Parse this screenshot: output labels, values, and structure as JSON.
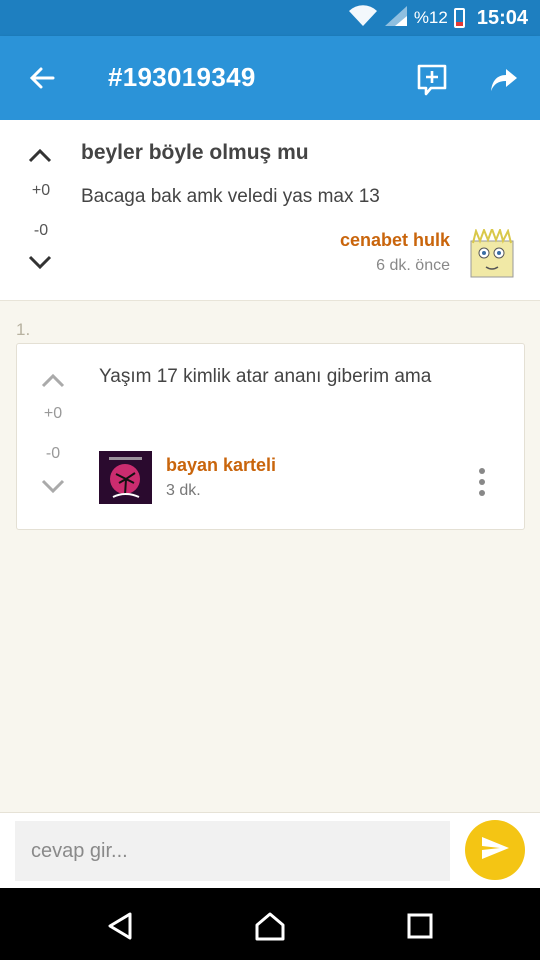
{
  "status_bar": {
    "battery": "%12",
    "time": "15:04",
    "icons": [
      "wifi-icon",
      "signal-icon",
      "battery-icon"
    ]
  },
  "app_bar": {
    "title": "#193019349",
    "icons": [
      "back-arrow-icon",
      "add-comment-icon",
      "share-icon"
    ]
  },
  "post": {
    "title": "beyler böyle olmuş mu",
    "body": "Bacaga bak amk veledi yas max 13",
    "upvotes": "+0",
    "downvotes": "-0",
    "author": "cenabet hulk",
    "time": "6 dk. önce"
  },
  "comments": [
    {
      "index": "1.",
      "text": "Yaşım 17 kimlik atar ananı giberim ama",
      "upvotes": "+0",
      "downvotes": "-0",
      "author": "bayan karteli",
      "time": "3 dk."
    }
  ],
  "reply": {
    "placeholder": "cevap gir..."
  },
  "colors": {
    "primary": "#2b93d8",
    "status": "#1e7fc0",
    "author": "#c9650c",
    "send": "#f4c514",
    "background": "#f8f6ee"
  }
}
